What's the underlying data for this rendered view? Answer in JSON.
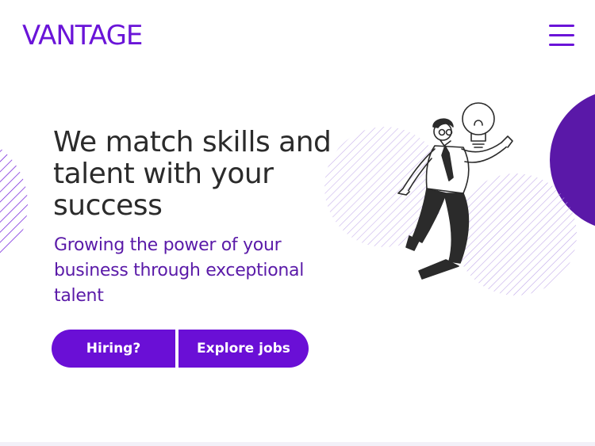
{
  "header": {
    "brand": "VANTAGE",
    "menu_icon": "hamburger-menu-icon"
  },
  "hero": {
    "title": "We match skills and talent with your success",
    "subtitle": "Growing the power of your business through exceptional talent",
    "illustration_icon": "floating-businessman-lightbulb-illustration"
  },
  "actions": {
    "hiring_label": "Hiring?",
    "explore_label": "Explore jobs"
  },
  "colors": {
    "brand": "#6a14d8",
    "button": "#6a0fd6",
    "subtitle": "#5a1aa8",
    "accent_circle": "#5a18a8",
    "stripes": "#b69be6",
    "text": "#2b2b2b"
  }
}
